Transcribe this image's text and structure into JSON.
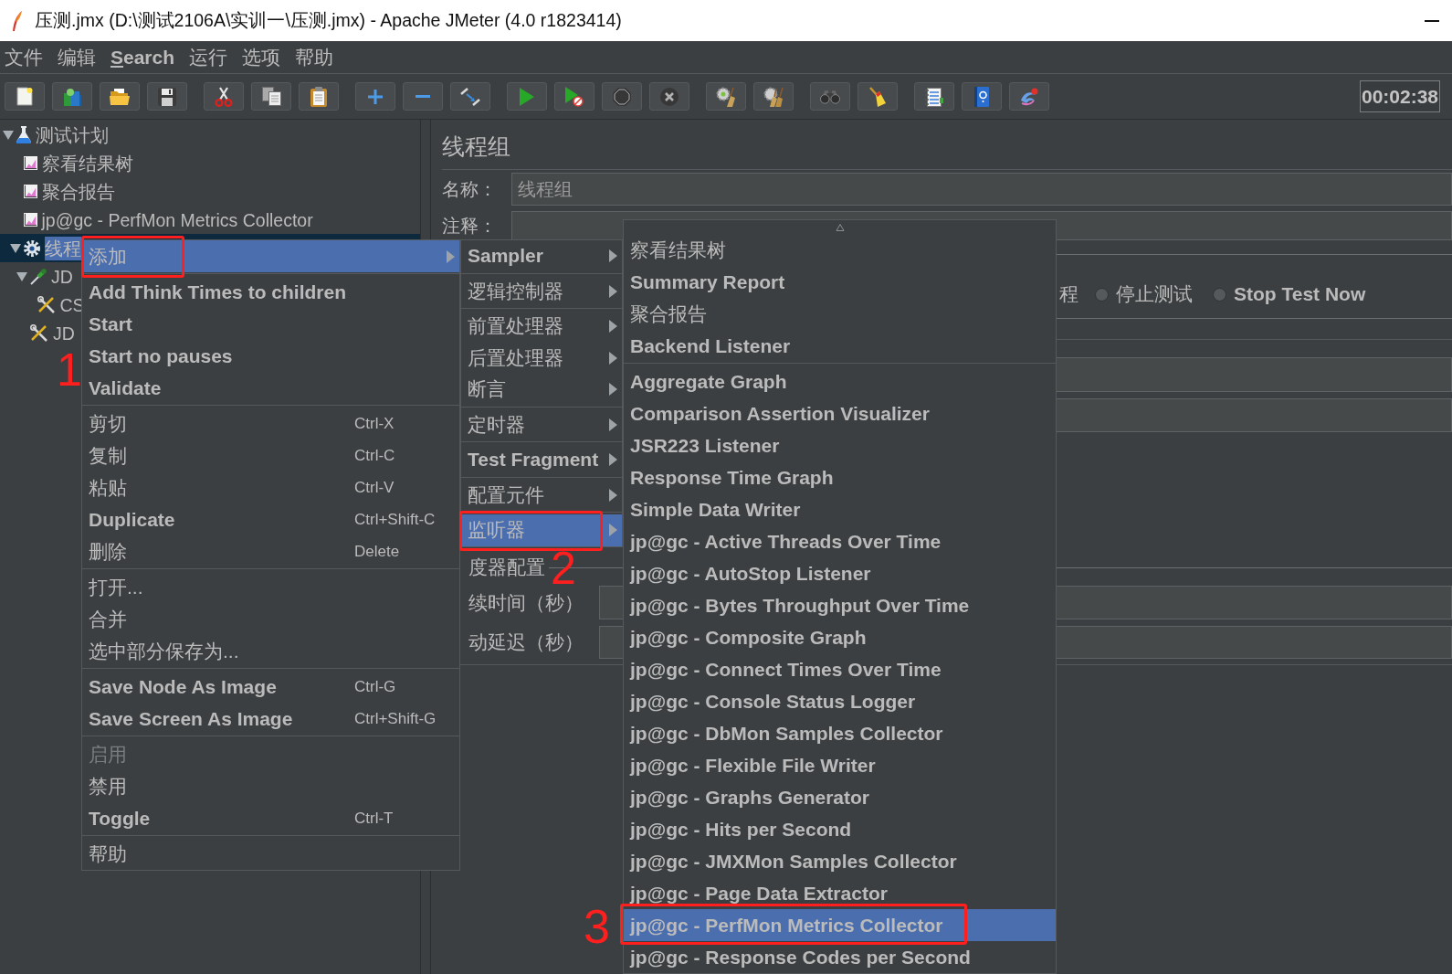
{
  "window": {
    "title": "压测.jmx (D:\\测试2106A\\实训一\\压测.jmx) - Apache JMeter (4.0 r1823414)"
  },
  "menu_bar": [
    {
      "label": "文件",
      "underlined_initial": false
    },
    {
      "label": "编辑",
      "underlined_initial": false
    },
    {
      "label": "Search",
      "underlined_initial": true
    },
    {
      "label": "运行",
      "underlined_initial": false
    },
    {
      "label": "选项",
      "underlined_initial": false
    },
    {
      "label": "帮助",
      "underlined_initial": false
    }
  ],
  "toolbar": {
    "groups": [
      [
        {
          "kind": "new",
          "disabled": false
        },
        {
          "kind": "templates",
          "disabled": false
        },
        {
          "kind": "open",
          "disabled": false
        },
        {
          "kind": "save",
          "disabled": false
        }
      ],
      [
        {
          "kind": "cut",
          "disabled": false
        },
        {
          "kind": "copy",
          "disabled": false
        },
        {
          "kind": "paste",
          "disabled": false
        }
      ],
      [
        {
          "kind": "expand",
          "disabled": false
        },
        {
          "kind": "collapse",
          "disabled": false
        },
        {
          "kind": "toggle",
          "disabled": false
        }
      ],
      [
        {
          "kind": "start",
          "disabled": false
        },
        {
          "kind": "start-no-pauses",
          "disabled": false
        },
        {
          "kind": "stop",
          "disabled": true
        },
        {
          "kind": "shutdown",
          "disabled": true
        }
      ],
      [
        {
          "kind": "clear",
          "disabled": false
        },
        {
          "kind": "clear-all",
          "disabled": false
        }
      ],
      [
        {
          "kind": "search",
          "disabled": false
        },
        {
          "kind": "reset-search",
          "disabled": false
        }
      ],
      [
        {
          "kind": "function-helper",
          "disabled": false
        },
        {
          "kind": "help",
          "disabled": false
        },
        {
          "kind": "remote",
          "disabled": false
        }
      ]
    ],
    "timer": "00:02:38"
  },
  "tree": [
    {
      "label": "测试计划",
      "kind": "plan",
      "expanded": true,
      "selected": false,
      "children": [
        {
          "label": "察看结果树",
          "kind": "listener",
          "selected": false
        },
        {
          "label": "聚合报告",
          "kind": "listener",
          "selected": false
        },
        {
          "label": "jp@gc - PerfMon Metrics Collector",
          "kind": "listener",
          "selected": false
        },
        {
          "label": "线程",
          "kind": "thread-group",
          "expanded": true,
          "selected": true,
          "children": [
            {
              "label": "JD",
              "kind": "sampler",
              "expanded": true,
              "selected": false,
              "children": [
                {
                  "label": "CS",
                  "kind": "config",
                  "selected": false
                }
              ]
            },
            {
              "label": "JD",
              "kind": "config",
              "selected": false
            }
          ]
        }
      ]
    }
  ],
  "editor": {
    "title": "线程组",
    "name_label": "名称：",
    "name_value": "线程组",
    "comment_label": "注释：",
    "error_action": {
      "partial_label": "程",
      "options": [
        {
          "label": "停止测试",
          "selected": false
        },
        {
          "label": "Stop Test Now",
          "selected": false
        }
      ]
    },
    "scheduler": {
      "title": "度器配置",
      "rows": [
        {
          "label": "续时间（秒）"
        },
        {
          "label": "动延迟（秒）"
        }
      ]
    }
  },
  "context_menu": {
    "groups": [
      [
        {
          "label": "添加",
          "submenu": true,
          "selected": true,
          "disabled": false
        }
      ],
      [
        {
          "label": "Add Think Times to children",
          "submenu": false,
          "selected": false,
          "disabled": false
        },
        {
          "label": "Start",
          "submenu": false,
          "selected": false,
          "disabled": false
        },
        {
          "label": "Start no pauses",
          "submenu": false,
          "selected": false,
          "disabled": false
        },
        {
          "label": "Validate",
          "submenu": false,
          "selected": false,
          "disabled": false
        }
      ],
      [
        {
          "label": "剪切",
          "shortcut": "Ctrl-X",
          "submenu": false,
          "selected": false,
          "disabled": false
        },
        {
          "label": "复制",
          "shortcut": "Ctrl-C",
          "submenu": false,
          "selected": false,
          "disabled": false
        },
        {
          "label": "粘贴",
          "shortcut": "Ctrl-V",
          "submenu": false,
          "selected": false,
          "disabled": false
        },
        {
          "label": "Duplicate",
          "shortcut": "Ctrl+Shift-C",
          "submenu": false,
          "selected": false,
          "disabled": false
        },
        {
          "label": "删除",
          "shortcut": "Delete",
          "submenu": false,
          "selected": false,
          "disabled": false
        }
      ],
      [
        {
          "label": "打开...",
          "submenu": false,
          "selected": false,
          "disabled": false
        },
        {
          "label": "合并",
          "submenu": false,
          "selected": false,
          "disabled": false
        },
        {
          "label": "选中部分保存为...",
          "submenu": false,
          "selected": false,
          "disabled": false
        }
      ],
      [
        {
          "label": "Save Node As Image",
          "shortcut": "Ctrl-G",
          "submenu": false,
          "selected": false,
          "disabled": false
        },
        {
          "label": "Save Screen As Image",
          "shortcut": "Ctrl+Shift-G",
          "submenu": false,
          "selected": false,
          "disabled": false
        }
      ],
      [
        {
          "label": "启用",
          "submenu": false,
          "selected": false,
          "disabled": true
        },
        {
          "label": "禁用",
          "submenu": false,
          "selected": false,
          "disabled": false
        },
        {
          "label": "Toggle",
          "shortcut": "Ctrl-T",
          "submenu": false,
          "selected": false,
          "disabled": false
        }
      ],
      [
        {
          "label": "帮助",
          "submenu": false,
          "selected": false,
          "disabled": false
        }
      ]
    ]
  },
  "add_submenu": {
    "groups": [
      [
        {
          "label": "Sampler",
          "submenu": true,
          "selected": false
        }
      ],
      [
        {
          "label": "逻辑控制器",
          "submenu": true,
          "selected": false
        }
      ],
      [
        {
          "label": "前置处理器",
          "submenu": true,
          "selected": false
        },
        {
          "label": "后置处理器",
          "submenu": true,
          "selected": false
        },
        {
          "label": "断言",
          "submenu": true,
          "selected": false
        }
      ],
      [
        {
          "label": "定时器",
          "submenu": true,
          "selected": false
        }
      ],
      [
        {
          "label": "Test Fragment",
          "submenu": true,
          "selected": false
        }
      ],
      [
        {
          "label": "配置元件",
          "submenu": true,
          "selected": false
        }
      ],
      [
        {
          "label": "监听器",
          "submenu": true,
          "selected": true
        }
      ]
    ]
  },
  "listener_submenu": {
    "groups": [
      [
        {
          "label": "察看结果树",
          "selected": false
        },
        {
          "label": "Summary Report",
          "selected": false
        },
        {
          "label": "聚合报告",
          "selected": false
        },
        {
          "label": "Backend Listener",
          "selected": false
        }
      ],
      [
        {
          "label": "Aggregate Graph",
          "selected": false
        },
        {
          "label": "Comparison Assertion Visualizer",
          "selected": false
        },
        {
          "label": "JSR223 Listener",
          "selected": false
        },
        {
          "label": "Response Time Graph",
          "selected": false
        },
        {
          "label": "Simple Data Writer",
          "selected": false
        },
        {
          "label": "jp@gc - Active Threads Over Time",
          "selected": false
        },
        {
          "label": "jp@gc - AutoStop Listener",
          "selected": false
        },
        {
          "label": "jp@gc - Bytes Throughput Over Time",
          "selected": false
        },
        {
          "label": "jp@gc - Composite Graph",
          "selected": false
        },
        {
          "label": "jp@gc - Connect Times Over Time",
          "selected": false
        },
        {
          "label": "jp@gc - Console Status Logger",
          "selected": false
        },
        {
          "label": "jp@gc - DbMon Samples Collector",
          "selected": false
        },
        {
          "label": "jp@gc - Flexible File Writer",
          "selected": false
        },
        {
          "label": "jp@gc - Graphs Generator",
          "selected": false
        },
        {
          "label": "jp@gc - Hits per Second",
          "selected": false
        },
        {
          "label": "jp@gc - JMXMon Samples Collector",
          "selected": false
        },
        {
          "label": "jp@gc - Page Data Extractor",
          "selected": false
        },
        {
          "label": "jp@gc - PerfMon Metrics Collector",
          "selected": true
        },
        {
          "label": "jp@gc - Response Codes per Second",
          "selected": false
        }
      ]
    ]
  },
  "annotations": [
    {
      "label": "1"
    },
    {
      "label": "2"
    },
    {
      "label": "3"
    }
  ]
}
